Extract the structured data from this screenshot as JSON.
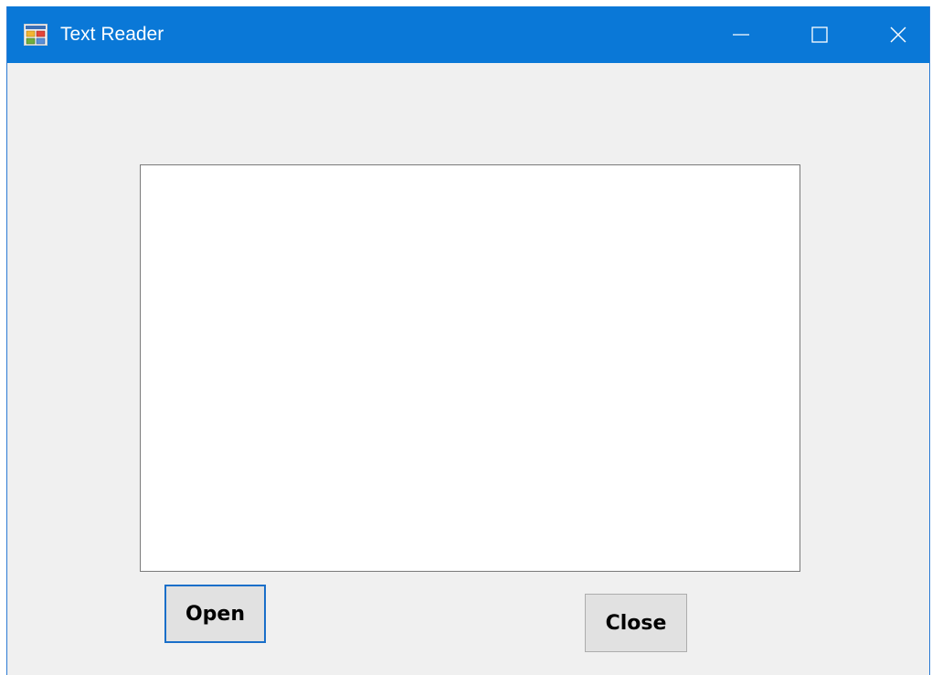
{
  "window": {
    "title": "Text Reader",
    "icon": "winforms-app-icon",
    "caption_buttons": {
      "minimize": "minimize-icon",
      "maximize": "maximize-icon",
      "close": "close-icon"
    },
    "colors": {
      "titlebar": "#0a78d7",
      "client_background": "#f0f0f0",
      "button_face": "#e1e1e1",
      "focus_border": "#1a6fc9"
    }
  },
  "form": {
    "text_box": {
      "value": ""
    },
    "open_button": {
      "label": "Open"
    },
    "close_button": {
      "label": "Close"
    }
  }
}
